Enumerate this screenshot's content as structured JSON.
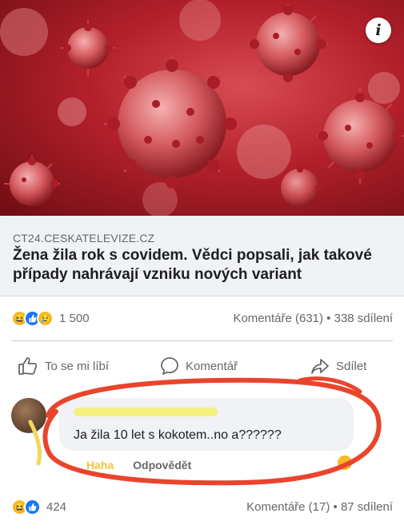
{
  "post": {
    "link": {
      "domain": "CT24.CESKATELEVIZE.CZ",
      "headline": "Žena žila rok s covidem. Vědci popsali, jak takové případy nahrávají vzniku nových variant"
    },
    "info_icon": "info-icon",
    "stats": {
      "reaction_icons": [
        "haha-reaction-icon",
        "like-reaction-icon",
        "sad-reaction-icon"
      ],
      "reactions_count": "1 500",
      "comments": "Komentáře (631)",
      "separator": "•",
      "shares": "338 sdílení"
    },
    "actions": {
      "like": "To se mi líbí",
      "comment": "Komentář",
      "share": "Sdílet"
    }
  },
  "comment": {
    "text": "Ja žila  10 let s kokotem..no a??????",
    "like_label": "Haha",
    "reply_label": "Odpovědět"
  },
  "shared_post_stats": {
    "reaction_icons": [
      "haha-reaction-icon",
      "like-reaction-icon"
    ],
    "reactions_count": "424",
    "comments": "Komentáře (17)",
    "separator": "•",
    "shares": "87 sdílení"
  },
  "colors": {
    "hero_red": "#b3202b",
    "annotation_red": "#e8452c",
    "like_blue": "#1877f2",
    "highlight_yellow": "#f3f07a"
  }
}
